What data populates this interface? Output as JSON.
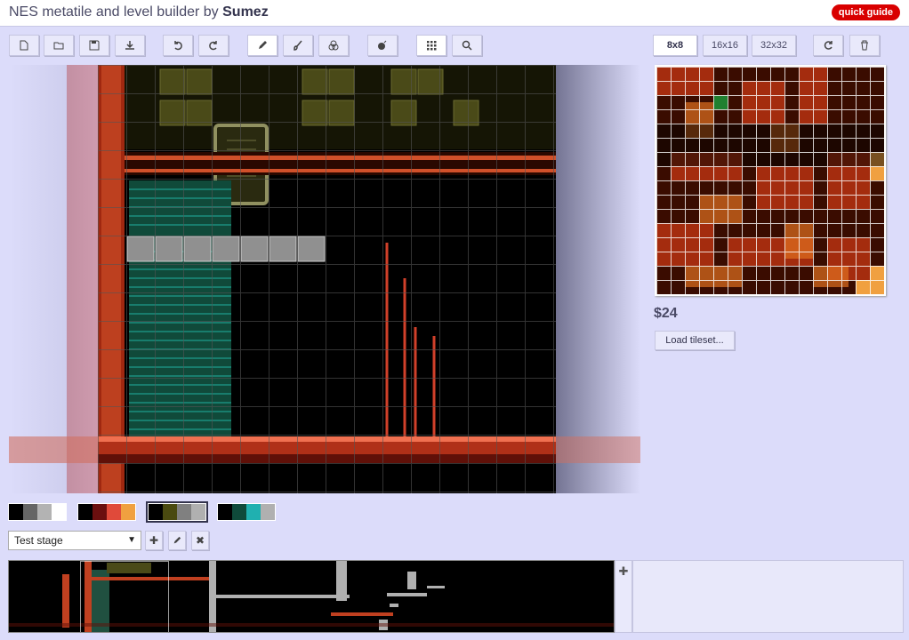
{
  "header": {
    "title_prefix": "NES metatile and level builder by ",
    "title_author": "Sumez",
    "quick_guide_label": "quick guide"
  },
  "toolbar": {
    "icons": [
      "new-file-icon",
      "open-folder-icon",
      "save-icon",
      "download-icon",
      "undo-icon",
      "redo-icon",
      "pencil-icon",
      "brush-icon",
      "stamp-icon",
      "bomb-icon",
      "grid-icon",
      "magnify-icon"
    ],
    "active": [
      "pencil-icon",
      "grid-icon"
    ]
  },
  "tile_size": {
    "options": [
      "8x8",
      "16x16",
      "32x32"
    ],
    "selected": "8x8",
    "refresh_icon": "refresh-icon",
    "trash_icon": "trash-icon"
  },
  "tileset": {
    "price": "$24",
    "load_label": "Load tileset..."
  },
  "palettes": [
    [
      "#000000",
      "#666666",
      "#b3b3b3",
      "#ffffff"
    ],
    [
      "#000000",
      "#6b0f0f",
      "#e04a3a",
      "#f0a040"
    ],
    [
      "#000000",
      "#4a4a10",
      "#808080",
      "#b0b0b0"
    ],
    [
      "#000000",
      "#0f4a3a",
      "#20b0b0",
      "#b0b0b0"
    ]
  ],
  "active_palette_index": 2,
  "stage": {
    "selected": "Test stage"
  },
  "colors": {
    "background": "#dcdcfa",
    "accent_red": "#d90000"
  }
}
